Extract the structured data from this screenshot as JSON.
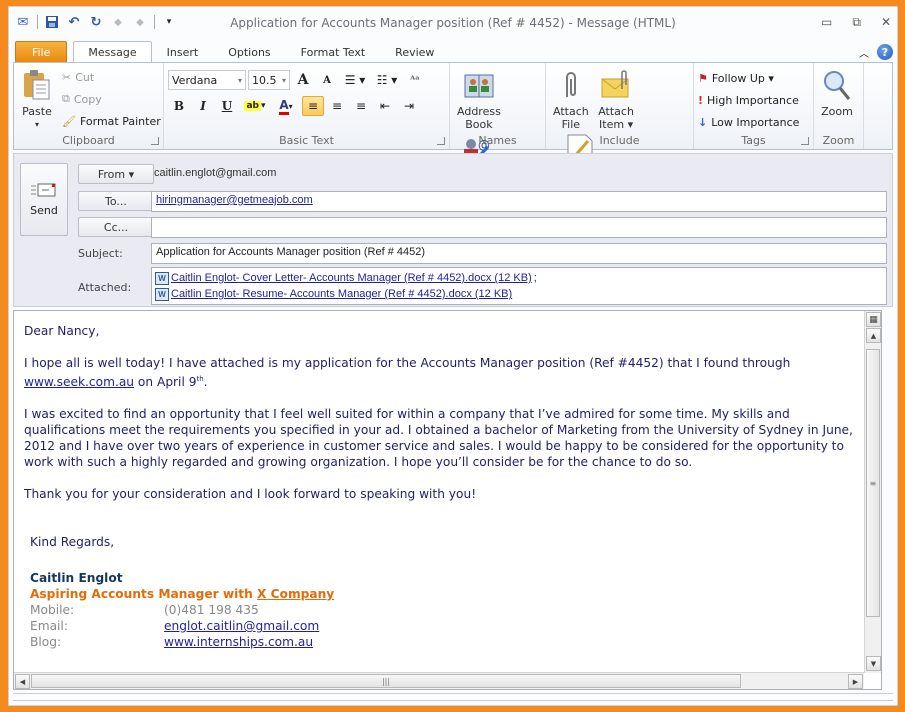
{
  "window": {
    "title": "Application for Accounts Manager position (Ref # 4452)  -  Message (HTML)",
    "controls": {
      "minimize": "▭",
      "restore": "⧉",
      "close": "✕"
    }
  },
  "qat": [
    "outlook-icon",
    "save-icon",
    "undo-icon",
    "redo-icon",
    "previous-icon",
    "next-icon",
    "customize-qat-icon"
  ],
  "tabs": [
    {
      "label": "File"
    },
    {
      "label": "Message"
    },
    {
      "label": "Insert"
    },
    {
      "label": "Options"
    },
    {
      "label": "Format Text"
    },
    {
      "label": "Review"
    }
  ],
  "ribbon": {
    "clipboard": {
      "label": "Clipboard",
      "paste": "Paste",
      "cut": "Cut",
      "copy": "Copy",
      "format_painter": "Format Painter"
    },
    "basic_text": {
      "label": "Basic Text",
      "font": "Verdana",
      "size": "10.5",
      "bold": "B",
      "italic": "I",
      "underline": "U",
      "grow": "A",
      "shrink": "A"
    },
    "names": {
      "label": "Names",
      "address_book": [
        "Address",
        "Book"
      ],
      "check_names": [
        "Check",
        "Names"
      ]
    },
    "include": {
      "label": "Include",
      "attach_file": [
        "Attach",
        "File"
      ],
      "attach_item": [
        "Attach",
        "Item ▾"
      ],
      "signature": [
        "Signature",
        "▾"
      ]
    },
    "tags": {
      "label": "Tags",
      "follow_up": "Follow Up ▾",
      "high_importance": "High Importance",
      "low_importance": "Low Importance"
    },
    "zoom": {
      "label": "Zoom",
      "zoom": "Zoom"
    }
  },
  "compose": {
    "send": "Send",
    "from_button": "From ▾",
    "from_value": "caitlin.englot@gmail.com",
    "to_button": "To...",
    "to_value": "hiringmanager@getmeajob.com",
    "cc_button": "Cc...",
    "cc_value": "",
    "subject_label": "Subject:",
    "subject_value": "Application for Accounts Manager position (Ref # 4452)",
    "attached_label": "Attached:",
    "attachments": [
      {
        "name": "Caitlin Englot- Cover Letter- Accounts Manager (Ref # 4452).docx (12 KB)",
        "sep": ";"
      },
      {
        "name": "Caitlin Englot- Resume- Accounts Manager (Ref # 4452).docx (12 KB)",
        "sep": ""
      }
    ]
  },
  "body": {
    "greeting": "Dear Nancy,",
    "p1_a": "I hope all is well today! I have attached is my application for the Accounts Manager position (Ref #4452) that I found through ",
    "p1_link": "www.seek.com.au",
    "p1_b": " on April 9",
    "p1_sup": "th",
    "p1_c": ".",
    "p2": "I was excited to find an opportunity that I feel well suited for within a company that I’ve admired for some time. My skills and qualifications meet the requirements you specified in your ad. I obtained a bachelor of Marketing from the University of Sydney in June, 2012 and I have over two years of experience in customer service and sales. I would be happy to be considered for the opportunity to work with such a highly regarded and growing organization. I hope you’ll consider be for the chance to do so.",
    "p3": "Thank you for your consideration and I look forward to speaking with you!",
    "closing": "Kind Regards,",
    "sig_name": "Caitlin Englot",
    "sig_title": "Aspiring Accounts Manager with ",
    "sig_company": "X Company",
    "sig_rows": [
      {
        "k": "Mobile:",
        "v": "(0)481 198 435",
        "link": false
      },
      {
        "k": "Email:",
        "v": "englot.caitlin@gmail.com",
        "link": true
      },
      {
        "k": "Blog:",
        "v": "www.internships.com.au",
        "link": true
      }
    ]
  },
  "colors": {
    "frame": "#f58a1f",
    "file_tab": "#e8880d",
    "body_text": "#1f1f6b",
    "signature_name": "#17365d",
    "signature_title": "#e36c09"
  }
}
